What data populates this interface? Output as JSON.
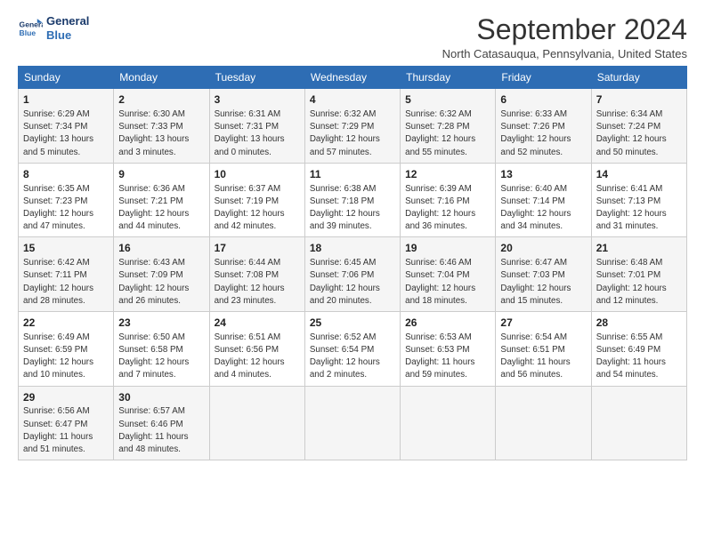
{
  "header": {
    "logo_line1": "General",
    "logo_line2": "Blue",
    "title": "September 2024",
    "subtitle": "North Catasauqua, Pennsylvania, United States"
  },
  "columns": [
    "Sunday",
    "Monday",
    "Tuesday",
    "Wednesday",
    "Thursday",
    "Friday",
    "Saturday"
  ],
  "weeks": [
    [
      {
        "day": "1",
        "lines": [
          "Sunrise: 6:29 AM",
          "Sunset: 7:34 PM",
          "Daylight: 13 hours",
          "and 5 minutes."
        ]
      },
      {
        "day": "2",
        "lines": [
          "Sunrise: 6:30 AM",
          "Sunset: 7:33 PM",
          "Daylight: 13 hours",
          "and 3 minutes."
        ]
      },
      {
        "day": "3",
        "lines": [
          "Sunrise: 6:31 AM",
          "Sunset: 7:31 PM",
          "Daylight: 13 hours",
          "and 0 minutes."
        ]
      },
      {
        "day": "4",
        "lines": [
          "Sunrise: 6:32 AM",
          "Sunset: 7:29 PM",
          "Daylight: 12 hours",
          "and 57 minutes."
        ]
      },
      {
        "day": "5",
        "lines": [
          "Sunrise: 6:32 AM",
          "Sunset: 7:28 PM",
          "Daylight: 12 hours",
          "and 55 minutes."
        ]
      },
      {
        "day": "6",
        "lines": [
          "Sunrise: 6:33 AM",
          "Sunset: 7:26 PM",
          "Daylight: 12 hours",
          "and 52 minutes."
        ]
      },
      {
        "day": "7",
        "lines": [
          "Sunrise: 6:34 AM",
          "Sunset: 7:24 PM",
          "Daylight: 12 hours",
          "and 50 minutes."
        ]
      }
    ],
    [
      {
        "day": "8",
        "lines": [
          "Sunrise: 6:35 AM",
          "Sunset: 7:23 PM",
          "Daylight: 12 hours",
          "and 47 minutes."
        ]
      },
      {
        "day": "9",
        "lines": [
          "Sunrise: 6:36 AM",
          "Sunset: 7:21 PM",
          "Daylight: 12 hours",
          "and 44 minutes."
        ]
      },
      {
        "day": "10",
        "lines": [
          "Sunrise: 6:37 AM",
          "Sunset: 7:19 PM",
          "Daylight: 12 hours",
          "and 42 minutes."
        ]
      },
      {
        "day": "11",
        "lines": [
          "Sunrise: 6:38 AM",
          "Sunset: 7:18 PM",
          "Daylight: 12 hours",
          "and 39 minutes."
        ]
      },
      {
        "day": "12",
        "lines": [
          "Sunrise: 6:39 AM",
          "Sunset: 7:16 PM",
          "Daylight: 12 hours",
          "and 36 minutes."
        ]
      },
      {
        "day": "13",
        "lines": [
          "Sunrise: 6:40 AM",
          "Sunset: 7:14 PM",
          "Daylight: 12 hours",
          "and 34 minutes."
        ]
      },
      {
        "day": "14",
        "lines": [
          "Sunrise: 6:41 AM",
          "Sunset: 7:13 PM",
          "Daylight: 12 hours",
          "and 31 minutes."
        ]
      }
    ],
    [
      {
        "day": "15",
        "lines": [
          "Sunrise: 6:42 AM",
          "Sunset: 7:11 PM",
          "Daylight: 12 hours",
          "and 28 minutes."
        ]
      },
      {
        "day": "16",
        "lines": [
          "Sunrise: 6:43 AM",
          "Sunset: 7:09 PM",
          "Daylight: 12 hours",
          "and 26 minutes."
        ]
      },
      {
        "day": "17",
        "lines": [
          "Sunrise: 6:44 AM",
          "Sunset: 7:08 PM",
          "Daylight: 12 hours",
          "and 23 minutes."
        ]
      },
      {
        "day": "18",
        "lines": [
          "Sunrise: 6:45 AM",
          "Sunset: 7:06 PM",
          "Daylight: 12 hours",
          "and 20 minutes."
        ]
      },
      {
        "day": "19",
        "lines": [
          "Sunrise: 6:46 AM",
          "Sunset: 7:04 PM",
          "Daylight: 12 hours",
          "and 18 minutes."
        ]
      },
      {
        "day": "20",
        "lines": [
          "Sunrise: 6:47 AM",
          "Sunset: 7:03 PM",
          "Daylight: 12 hours",
          "and 15 minutes."
        ]
      },
      {
        "day": "21",
        "lines": [
          "Sunrise: 6:48 AM",
          "Sunset: 7:01 PM",
          "Daylight: 12 hours",
          "and 12 minutes."
        ]
      }
    ],
    [
      {
        "day": "22",
        "lines": [
          "Sunrise: 6:49 AM",
          "Sunset: 6:59 PM",
          "Daylight: 12 hours",
          "and 10 minutes."
        ]
      },
      {
        "day": "23",
        "lines": [
          "Sunrise: 6:50 AM",
          "Sunset: 6:58 PM",
          "Daylight: 12 hours",
          "and 7 minutes."
        ]
      },
      {
        "day": "24",
        "lines": [
          "Sunrise: 6:51 AM",
          "Sunset: 6:56 PM",
          "Daylight: 12 hours",
          "and 4 minutes."
        ]
      },
      {
        "day": "25",
        "lines": [
          "Sunrise: 6:52 AM",
          "Sunset: 6:54 PM",
          "Daylight: 12 hours",
          "and 2 minutes."
        ]
      },
      {
        "day": "26",
        "lines": [
          "Sunrise: 6:53 AM",
          "Sunset: 6:53 PM",
          "Daylight: 11 hours",
          "and 59 minutes."
        ]
      },
      {
        "day": "27",
        "lines": [
          "Sunrise: 6:54 AM",
          "Sunset: 6:51 PM",
          "Daylight: 11 hours",
          "and 56 minutes."
        ]
      },
      {
        "day": "28",
        "lines": [
          "Sunrise: 6:55 AM",
          "Sunset: 6:49 PM",
          "Daylight: 11 hours",
          "and 54 minutes."
        ]
      }
    ],
    [
      {
        "day": "29",
        "lines": [
          "Sunrise: 6:56 AM",
          "Sunset: 6:47 PM",
          "Daylight: 11 hours",
          "and 51 minutes."
        ]
      },
      {
        "day": "30",
        "lines": [
          "Sunrise: 6:57 AM",
          "Sunset: 6:46 PM",
          "Daylight: 11 hours",
          "and 48 minutes."
        ]
      },
      null,
      null,
      null,
      null,
      null
    ]
  ]
}
